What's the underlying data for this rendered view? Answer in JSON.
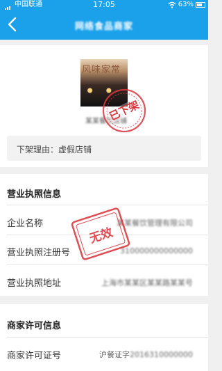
{
  "status_bar": {
    "carrier": "中国联通",
    "time": "17:05",
    "battery": "63%"
  },
  "header": {
    "title": "网络食品商家"
  },
  "shop": {
    "photo_sign": "风味家常",
    "name": "某某餐饮店铺",
    "status_stamp": "已下架",
    "reason": "下架理由：虚假店铺"
  },
  "license_section": {
    "title": "营业执照信息",
    "invalid_stamp": "无效",
    "rows": [
      {
        "label": "企业名称",
        "value": "某某餐饮管理有限公司"
      },
      {
        "label": "营业执照注册号",
        "value": "310000000000000"
      },
      {
        "label": "营业执照地址",
        "value": "上海市某某区某某路某某号"
      }
    ]
  },
  "permit_section": {
    "title": "商家许可信息",
    "rows": [
      {
        "label": "商家许可证号",
        "value_prefix": "沪餐证字",
        "value_rest": "2016310000000"
      }
    ]
  },
  "colors": {
    "primary": "#1aa1ea",
    "stamp_red": "#d9363e",
    "background": "#f0f0f0"
  },
  "icons": [
    "signal-icon",
    "wifi-icon",
    "battery-icon",
    "back-arrow-icon"
  ]
}
